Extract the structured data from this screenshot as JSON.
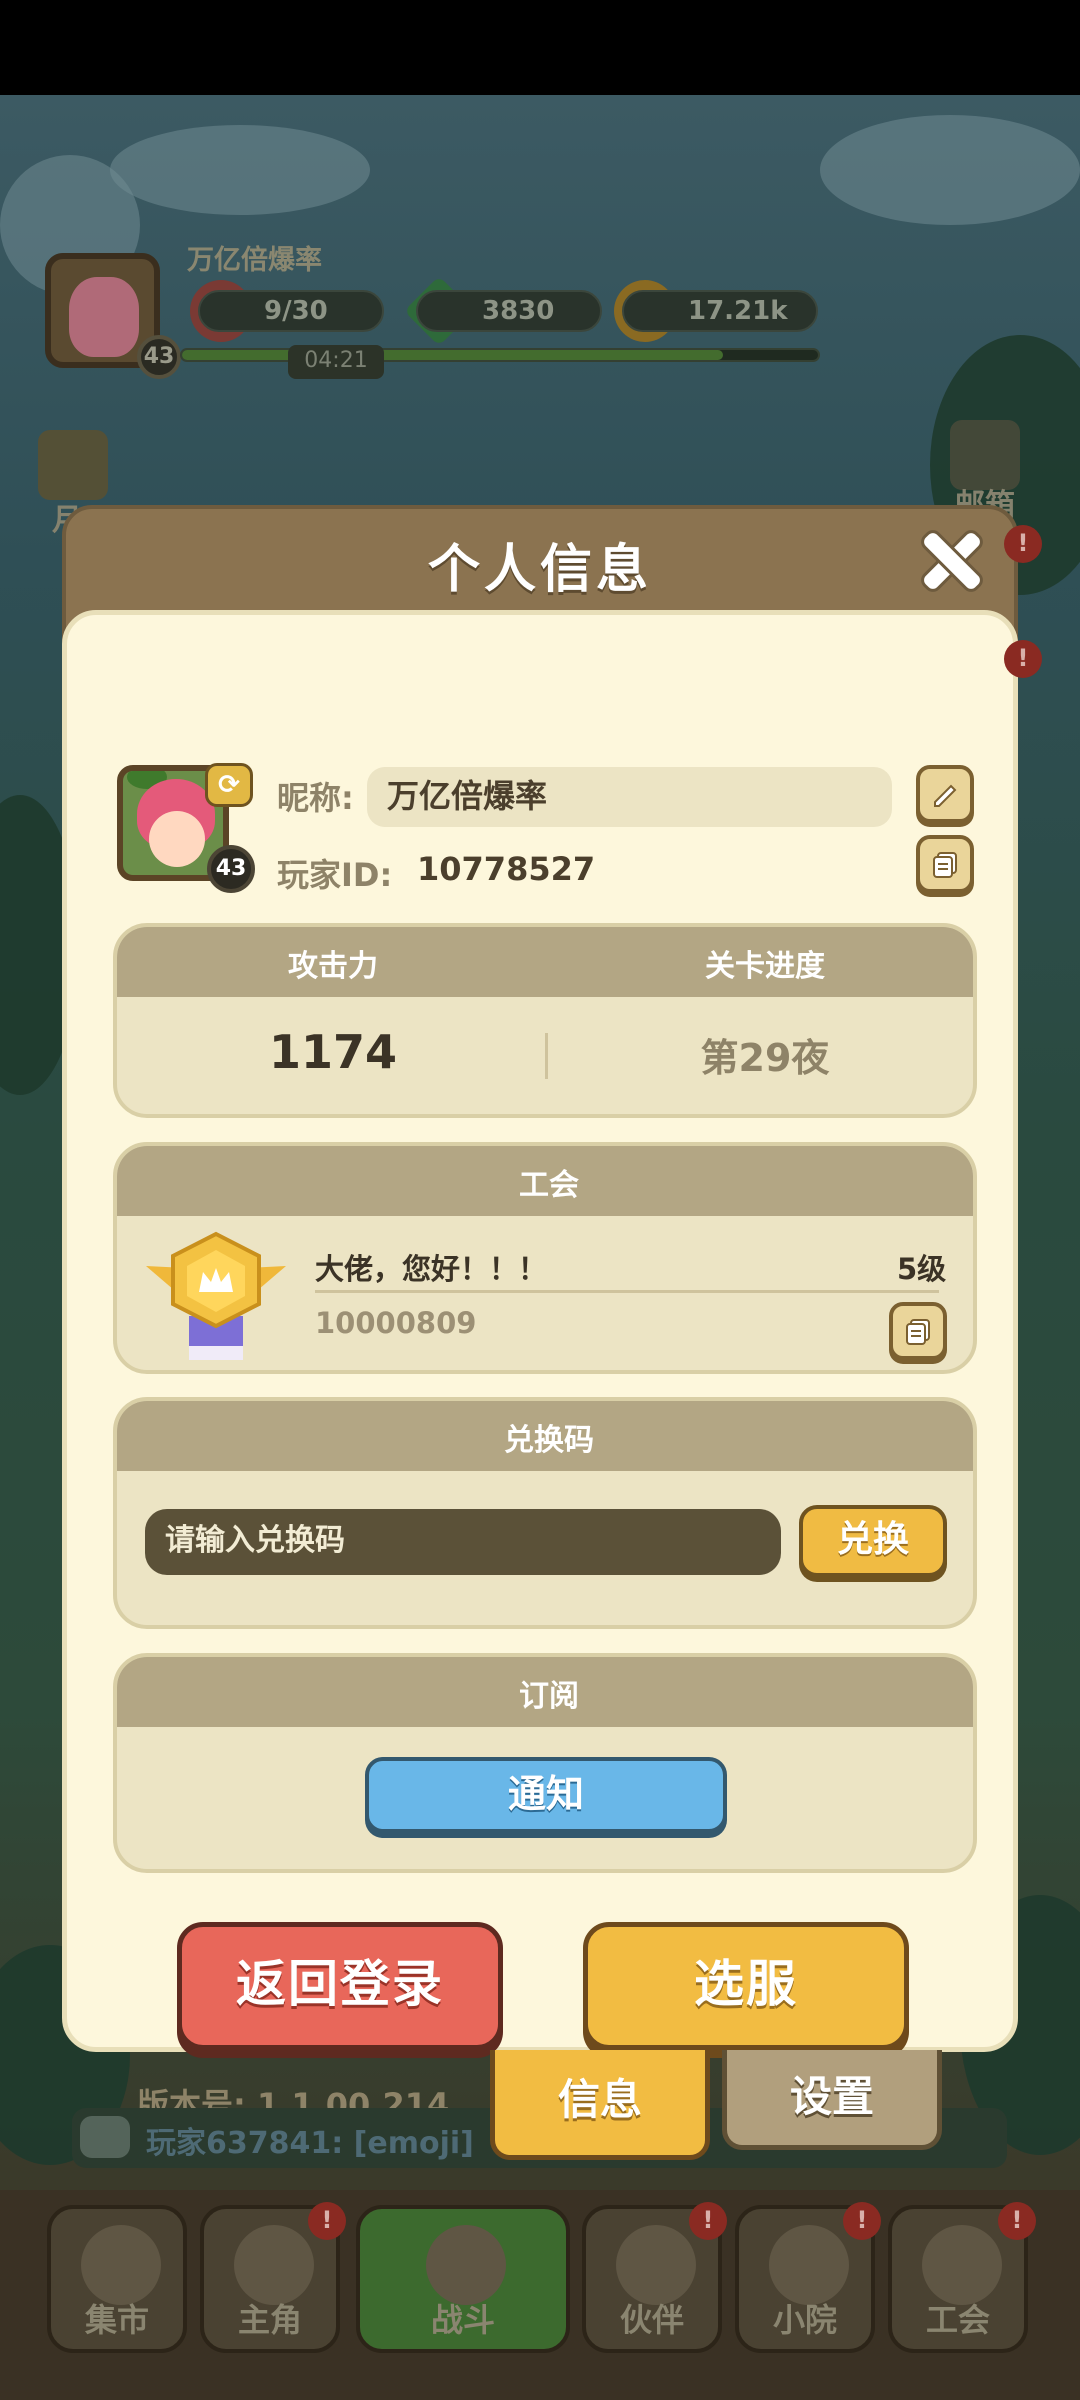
{
  "hud": {
    "player_name": "万亿倍爆率",
    "level": "43",
    "stamina": "9/30",
    "gems": "3830",
    "coins": "17.21k",
    "timer": "04:21",
    "xp_progress": 0.85
  },
  "side": {
    "mail_label": "邮箱",
    "left_label": "月"
  },
  "modal": {
    "title": "个人信息",
    "nickname_label": "昵称:",
    "nickname_value": "万亿倍爆率",
    "player_id_label": "玩家ID:",
    "player_id_value": "10778527",
    "avatar_level": "43",
    "stats": {
      "attack_header": "攻击力",
      "progress_header": "关卡进度",
      "attack_value": "1174",
      "progress_value": "第29夜"
    },
    "guild": {
      "header": "工会",
      "name": "大佬，您好！！！",
      "level": "5级",
      "id": "10000809"
    },
    "redeem": {
      "header": "兑换码",
      "placeholder": "请输入兑换码",
      "button": "兑换"
    },
    "subscribe": {
      "header": "订阅",
      "button": "通知"
    },
    "back_login": "返回登录",
    "select_server": "选服",
    "version": "版本号: 1.1.00.214"
  },
  "tabs": {
    "info": "信息",
    "settings": "设置"
  },
  "chat": {
    "text": "玩家637841: [emoji]"
  },
  "nav": [
    {
      "label": "集市"
    },
    {
      "label": "主角"
    },
    {
      "label": "战斗"
    },
    {
      "label": "伙伴"
    },
    {
      "label": "小院"
    },
    {
      "label": "工会"
    }
  ],
  "badge_text": "!",
  "colors": {
    "modal_bg": "#fdf7dc",
    "header_brown": "#8b7350",
    "red_button": "#e8675a",
    "yellow_button": "#f2bc42",
    "blue_button": "#69b7e8"
  }
}
